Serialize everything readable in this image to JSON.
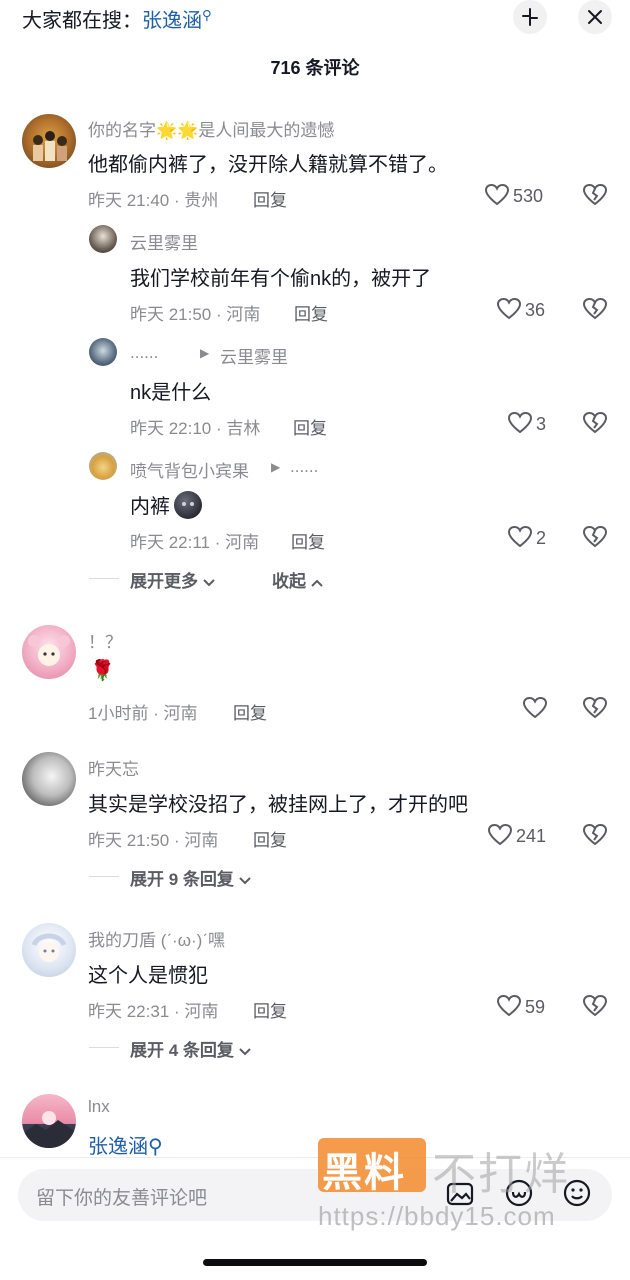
{
  "header": {
    "search_prefix": "大家都在搜：",
    "search_keyword": "张逸涵",
    "comment_count": "716 条评论"
  },
  "comments": [
    {
      "username": "你的名字🌟🌟是人间最大的遗憾",
      "content": "他都偷内裤了，没开除人籍就算不错了。",
      "meta": "昨天 21:40 · 贵州",
      "reply": "回复",
      "likes": "530"
    },
    {
      "username": "云里雾里",
      "content": "我们学校前年有个偷nk的，被开了",
      "meta": "昨天 21:50 · 河南",
      "reply": "回复",
      "likes": "36"
    },
    {
      "username": "......",
      "reply_to": "云里雾里",
      "content": "nk是什么",
      "meta": "昨天 22:10 · 吉林",
      "reply": "回复",
      "likes": "3"
    },
    {
      "username": "喷气背包小宾果",
      "reply_to": "......",
      "content": "内裤",
      "meta": "昨天 22:11 · 河南",
      "reply": "回复",
      "likes": "2"
    },
    {
      "username": "！？",
      "content": "🌹",
      "meta": "1小时前 · 河南",
      "reply": "回复",
      "likes": ""
    },
    {
      "username": "昨天忘",
      "content": "其实是学校没招了，被挂网上了，才开的吧",
      "meta": "昨天 21:50 · 河南",
      "reply": "回复",
      "likes": "241"
    },
    {
      "username": "我的刀盾 (ˊ·ω·)ˊ嘿",
      "content": "这个人是惯犯",
      "meta": "昨天 22:31 · 河南",
      "reply": "回复",
      "likes": "59"
    },
    {
      "username": "lnx",
      "content": "张逸涵"
    }
  ],
  "expand": {
    "more": "展开更多",
    "collapse": "收起",
    "expand_9": "展开 9 条回复",
    "expand_4": "展开 4 条回复"
  },
  "input": {
    "placeholder": "留下你的友善评论吧"
  },
  "watermark": {
    "text1": "黑料",
    "text2": "不打烊",
    "url": "https://bbdy15.com"
  },
  "colors": {
    "link_blue": "#1f5fa8",
    "meta_gray": "#8a8b91",
    "watermark_orange": "#f28a2d"
  }
}
